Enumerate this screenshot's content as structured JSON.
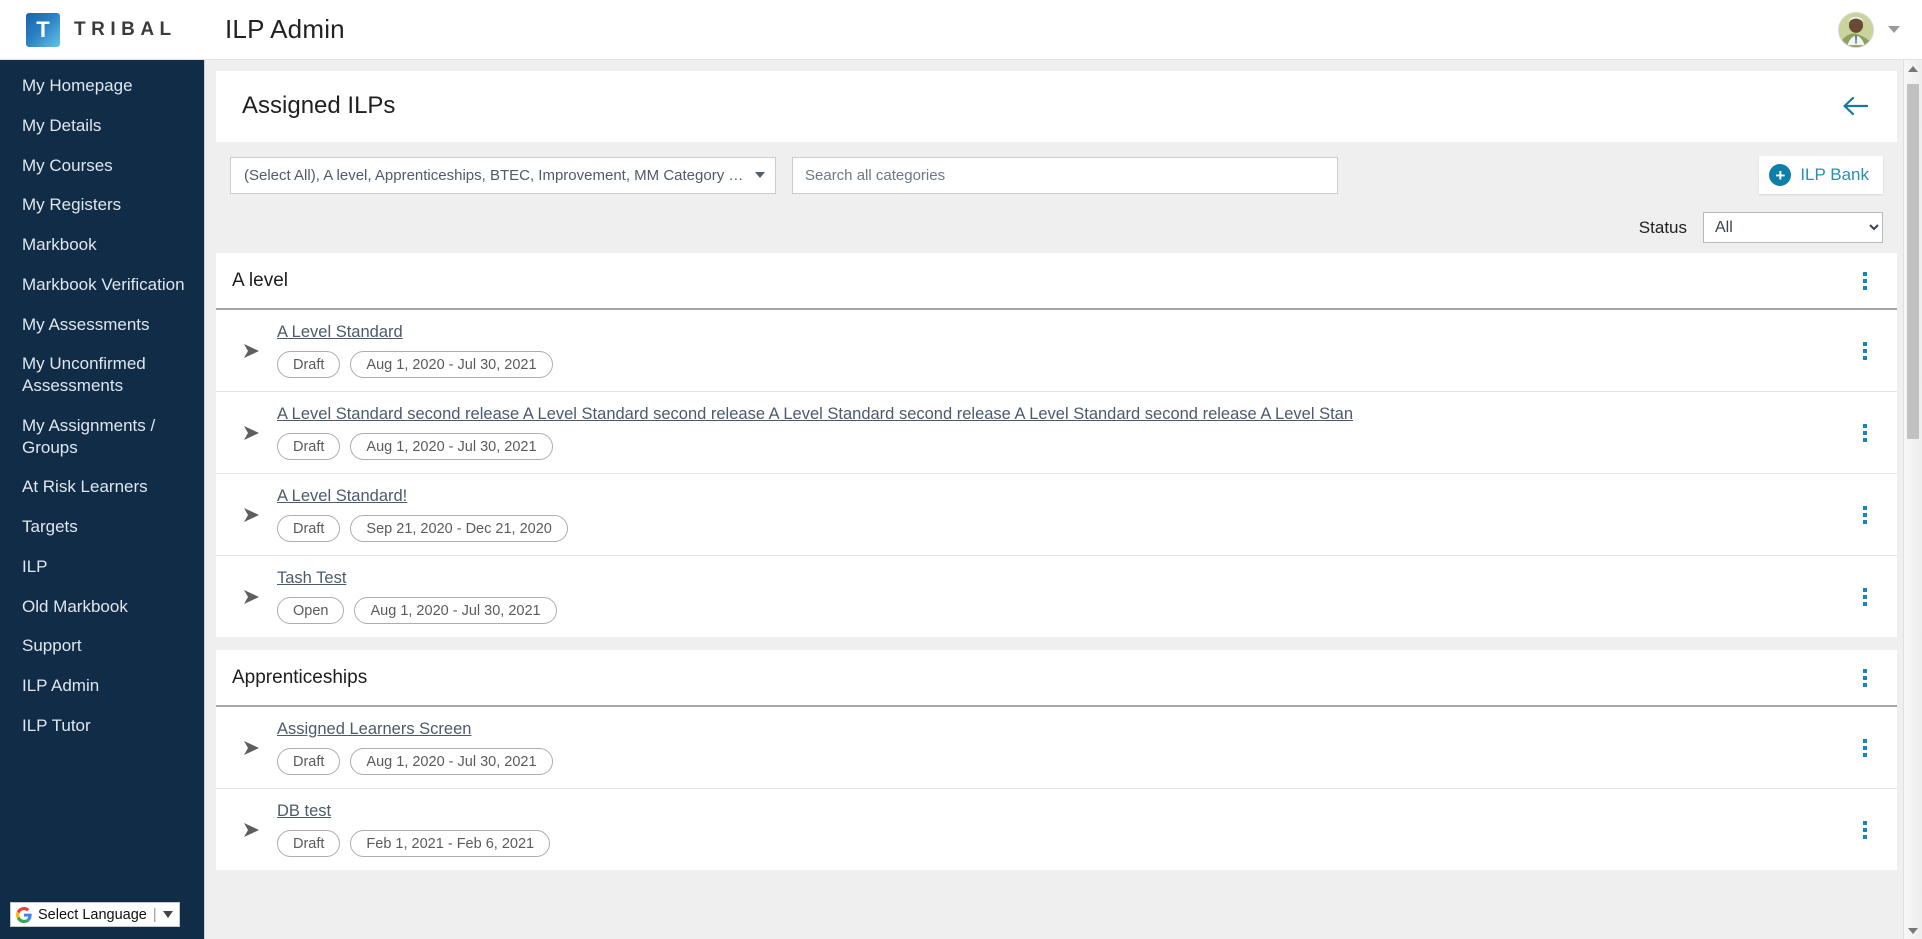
{
  "topbar": {
    "logo_letter": "T",
    "brand_name": "TRIBAL",
    "app_title": "ILP Admin",
    "avatar_name": "user-avatar",
    "caret_name": "user-menu-caret"
  },
  "sidebar": {
    "items": [
      {
        "label": "My Homepage"
      },
      {
        "label": "My Details"
      },
      {
        "label": "My Courses"
      },
      {
        "label": "My Registers"
      },
      {
        "label": "Markbook"
      },
      {
        "label": "Markbook Verification"
      },
      {
        "label": "My Assessments"
      },
      {
        "label": "My Unconfirmed Assessments"
      },
      {
        "label": "My Assignments / Groups"
      },
      {
        "label": "At Risk Learners"
      },
      {
        "label": "Targets"
      },
      {
        "label": "ILP"
      },
      {
        "label": "Old Markbook"
      },
      {
        "label": "Support"
      },
      {
        "label": "ILP Admin"
      },
      {
        "label": "ILP Tutor"
      }
    ],
    "language_widget": {
      "label": "Select Language",
      "separator": "|"
    }
  },
  "page": {
    "title": "Assigned ILPs",
    "back_icon": "arrow-left-icon"
  },
  "filters": {
    "category_multiselect_value": "(Select All), A level, Apprenticeships, BTEC, Improvement, MM Category used in IL...",
    "search_placeholder": "Search all categories",
    "search_value": "",
    "ilp_bank_label": "ILP Bank",
    "ilp_bank_plus": "+",
    "status_label": "Status",
    "status_value": "All",
    "status_options": [
      "All"
    ]
  },
  "colors": {
    "sidebar_bg": "#102c47",
    "accent_link": "#2a8fb5",
    "kebab_dot": "#1287c4",
    "page_bg": "#efefef"
  },
  "groups": [
    {
      "title": "A level",
      "rows": [
        {
          "title": "A Level Standard",
          "status": "Draft",
          "dates": "Aug 1, 2020 - Jul 30, 2021"
        },
        {
          "title": "A Level Standard second release A Level Standard second release A Level Standard second release A Level Standard second release A Level Stan",
          "status": "Draft",
          "dates": "Aug 1, 2020 - Jul 30, 2021"
        },
        {
          "title": "A Level Standard!",
          "status": "Draft",
          "dates": "Sep 21, 2020 - Dec 21, 2020"
        },
        {
          "title": "Tash Test",
          "status": "Open",
          "dates": "Aug 1, 2020 - Jul 30, 2021"
        }
      ]
    },
    {
      "title": "Apprenticeships",
      "rows": [
        {
          "title": "Assigned Learners Screen",
          "status": "Draft",
          "dates": "Aug 1, 2020 - Jul 30, 2021"
        },
        {
          "title": "DB test",
          "status": "Draft",
          "dates": "Feb 1, 2021 - Feb 6, 2021"
        }
      ]
    }
  ]
}
